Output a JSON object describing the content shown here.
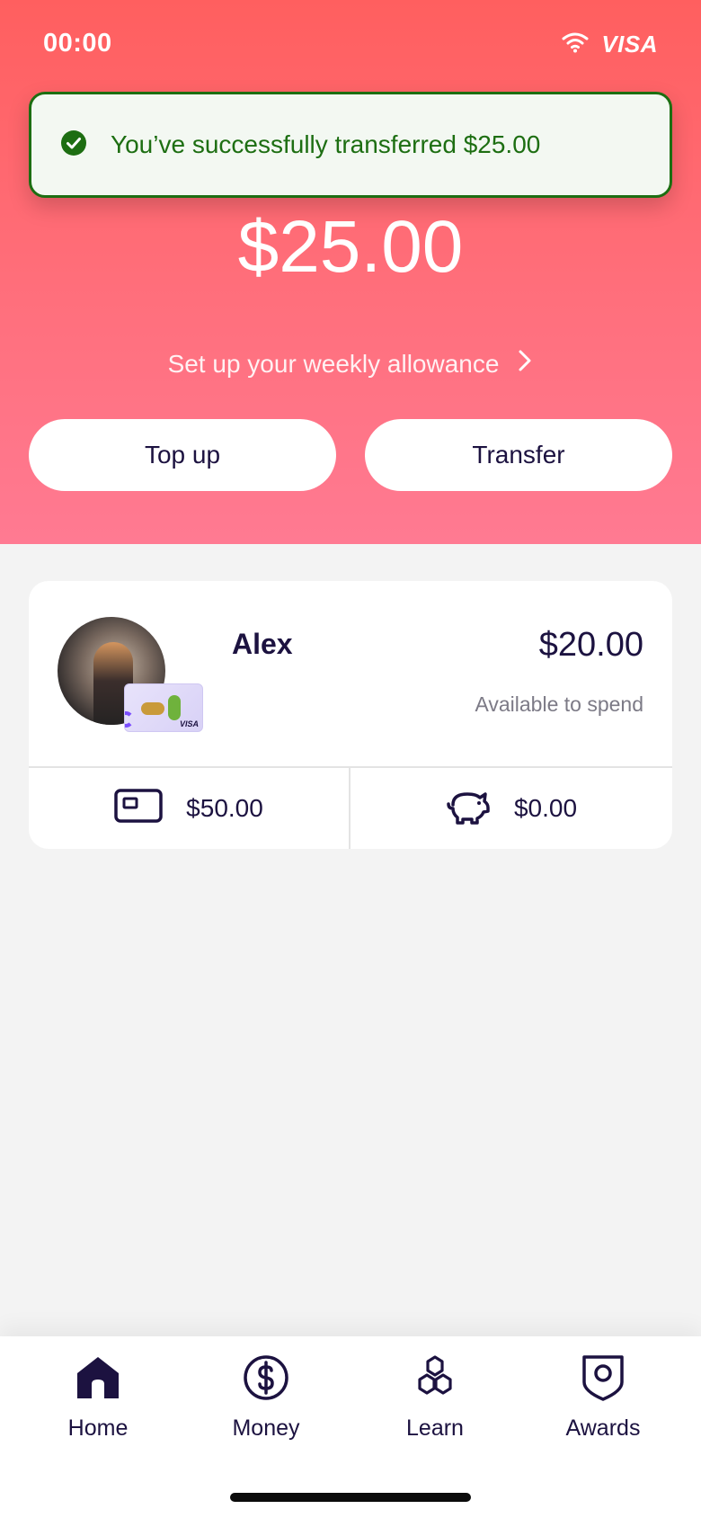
{
  "status_bar": {
    "time": "00:00",
    "brand": "VISA"
  },
  "toast": {
    "message": "You’ve successfully transferred $25.00"
  },
  "hero": {
    "balance": "$25.00",
    "allowance_link": "Set up your weekly allowance",
    "top_up_label": "Top up",
    "transfer_label": "Transfer"
  },
  "child_card": {
    "name": "Alex",
    "spend_amount": "$20.00",
    "spend_caption": "Available to spend",
    "card_balance": "$50.00",
    "savings_balance": "$0.00",
    "mini_card_brand": "VISA"
  },
  "nav": {
    "items": [
      {
        "label": "Home",
        "icon": "home-icon",
        "active": true
      },
      {
        "label": "Money",
        "icon": "dollar-circle-icon",
        "active": false
      },
      {
        "label": "Learn",
        "icon": "hexagons-icon",
        "active": false
      },
      {
        "label": "Awards",
        "icon": "shield-badge-icon",
        "active": false
      }
    ]
  },
  "colors": {
    "hero_top": "#ff5f5f",
    "hero_bottom": "#ff7a92",
    "success_green": "#1d6e12",
    "ink": "#1c1240"
  }
}
